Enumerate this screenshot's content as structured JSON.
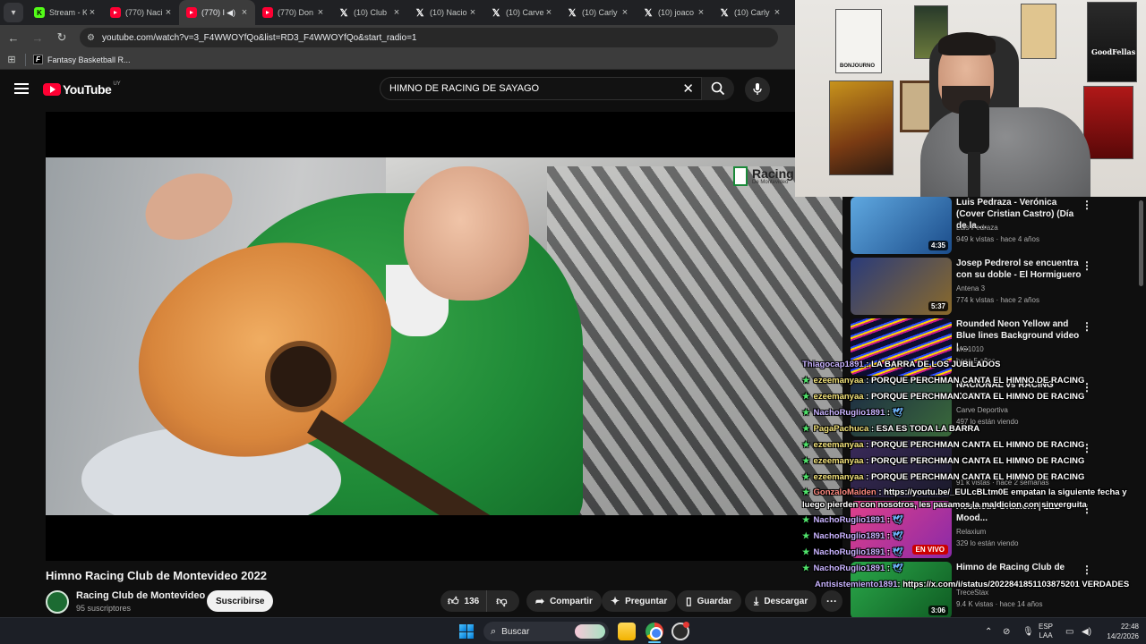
{
  "browser": {
    "tabs": [
      {
        "label": "Stream - K",
        "icon": "kick-icon"
      },
      {
        "label": "(770) Naci",
        "icon": "youtube-icon"
      },
      {
        "label": "(770) I",
        "icon": "youtube-icon",
        "active": true
      },
      {
        "label": "(770) Don",
        "icon": "youtube-icon"
      },
      {
        "label": "(10) Club",
        "icon": "x-icon"
      },
      {
        "label": "(10) Nacio",
        "icon": "x-icon"
      },
      {
        "label": "(10) Carve",
        "icon": "x-icon"
      },
      {
        "label": "(10) Carly",
        "icon": "x-icon"
      },
      {
        "label": "(10) joaco",
        "icon": "x-icon"
      },
      {
        "label": "(10) Carly",
        "icon": "x-icon"
      }
    ],
    "url": "youtube.com/watch?v=3_F4WWOYfQo&list=RD3_F4WWOYfQo&start_radio=1",
    "bookmark": "Fantasy Basketball R..."
  },
  "youtube": {
    "logo_text": "YouTube",
    "country": "UY",
    "search_value": "HIMNO DE RACING DE SAYAGO",
    "watermark": {
      "line1": "Racing",
      "line2": "De Montevideo"
    },
    "video": {
      "title": "Himno Racing Club de Montevideo 2022",
      "channel": "Racing Club de Montevideo",
      "subscribers": "95 suscriptores",
      "subscribe_label": "Suscribirse",
      "likes": "136",
      "share_label": "Compartir",
      "ask_label": "Preguntar",
      "save_label": "Guardar",
      "download_label": "Descargar"
    },
    "recommendations": [
      {
        "title": "Luis Pedraza - Verónica (Cover Cristian Castro) (Día de la ...",
        "channel": "Luis Pedraza",
        "meta": "949 k vistas · hace 4 años",
        "duration": "4:35"
      },
      {
        "title": "Josep Pedrerol se encuentra con su doble - El Hormiguero",
        "channel": "Antena 3",
        "meta": "774 k vistas · hace 2 años",
        "duration": "5:37"
      },
      {
        "title": "Rounded Neon Yellow and Blue lines Background video | ...",
        "channel": "MG1010",
        "meta": "hace 5 años",
        "duration": ""
      },
      {
        "title": "NACIONAL vs RACING CARVE",
        "channel": "Carve Deportiva",
        "meta": "497 lo están viendo",
        "duration": ""
      },
      {
        "title": "",
        "channel": "",
        "meta": "91 k vistas · hace 2 semanas",
        "duration": ""
      },
      {
        "title": "Aesthetic Gradient | LED Mood...",
        "channel": "Relaxium",
        "meta": "329 lo están viendo",
        "live": "EN VIVO"
      },
      {
        "title": "Himno de Racing Club de",
        "channel": "TreceStax",
        "meta": "9.4 K vistas · hace 14 años",
        "duration": "3:06"
      }
    ]
  },
  "chat": [
    {
      "user": "Thiagocap1891",
      "text": ": LA BARRA DE LOS JUBILADOS"
    },
    {
      "user": "ezeemanyaa",
      "text": ": PORQUE PERCHMAN CANTA EL HIMNO DE RACING"
    },
    {
      "user": "ezeemanyaa",
      "text": ": PORQUE PERCHMAN CANTA EL HIMNO DE RACING"
    },
    {
      "user": "NachoRuglio1891",
      "text": ":"
    },
    {
      "user": "PagaPachuca",
      "text": ": ESA ES TODA LA BARRA"
    },
    {
      "user": "ezeemanyaa",
      "text": ": PORQUE PERCHMAN CANTA EL HIMNO DE RACING"
    },
    {
      "user": "ezeemanyaa",
      "text": ": PORQUE PERCHMAN CANTA EL HIMNO DE RACING"
    },
    {
      "user": "ezeemanyaa",
      "text": ": PORQUE PERCHMAN CANTA EL HIMNO DE RACING"
    },
    {
      "user": "GonzaloMaiden",
      "text": ": https://youtu.be/_EULcBLtm0E empatan la siguiente fecha y luego pierden con nosotros, les pasamos la maldicion con sinverguita"
    },
    {
      "user": "NachoRuglio1891",
      "text": ":"
    },
    {
      "user": "NachoRuglio1891",
      "text": ":"
    },
    {
      "user": "NachoRuglio1891",
      "text": ":"
    },
    {
      "user": "NachoRuglio1891",
      "text": ":"
    },
    {
      "user": "Antisistemiento1891",
      "text": ": https://x.com/i/status/2022841851103875201 VERDADES"
    }
  ],
  "webcam": {
    "poster_text_1": "BONJOURNO",
    "poster_text_2": "GoodFellas"
  },
  "taskbar": {
    "search_label": "Buscar",
    "lang_line1": "ESP",
    "lang_line2": "LAA",
    "time": "22:48",
    "date": "14/2/2026"
  }
}
